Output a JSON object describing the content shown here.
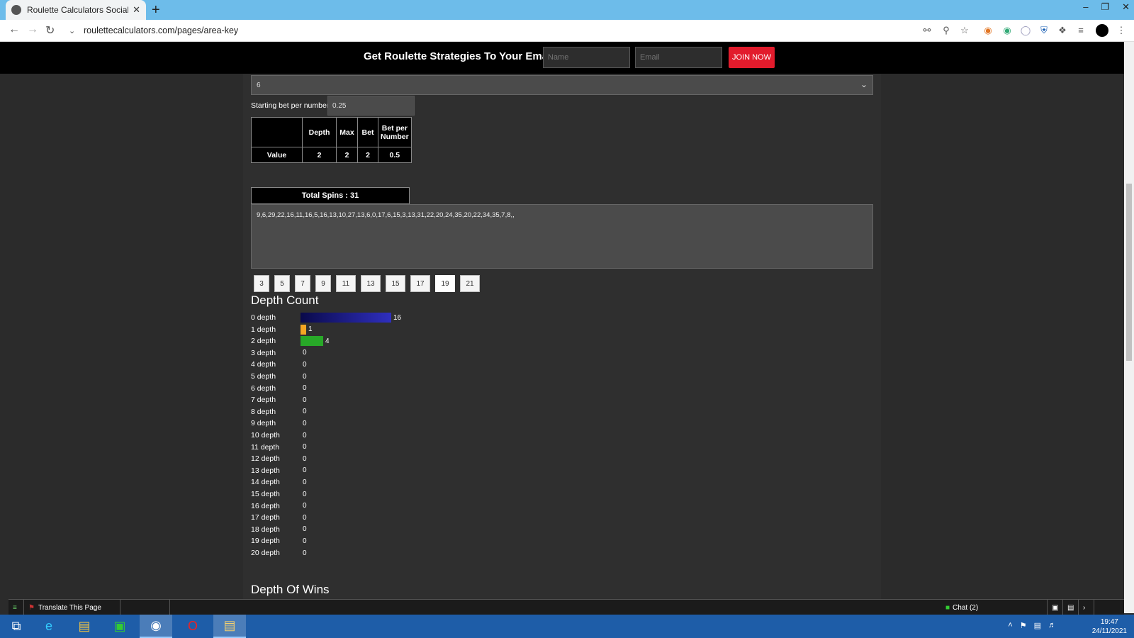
{
  "browser": {
    "tab_title": "Roulette Calculators Social Netw",
    "url": "roulettecalculators.com/pages/area-key",
    "new_tab": "+",
    "close_tab": "✕"
  },
  "promo": {
    "text": "Get Roulette Strategies To Your Email:",
    "name_placeholder": "Name",
    "email_placeholder": "Email",
    "join_label": "JOIN NOW"
  },
  "form": {
    "select_value": "6",
    "starting_bet_label": "Starting bet per number",
    "starting_bet_value": "0.25"
  },
  "value_table": {
    "headers": [
      "",
      "Depth",
      "Max",
      "Bet",
      "Bet per Number"
    ],
    "row_label": "Value",
    "values": [
      "2",
      "2",
      "2",
      "0.5"
    ]
  },
  "spins": {
    "header": "Total Spins : 31",
    "sequence": "9,6,29,22,16,11,16,5,16,13,10,27,13,6,0,17,6,15,3,13,31,22,20,24,35,20,22,34,35,7,8,,"
  },
  "number_buttons": [
    "3",
    "5",
    "7",
    "9",
    "11",
    "13",
    "15",
    "17",
    "19",
    "21"
  ],
  "depth_count": {
    "title": "Depth Count",
    "rows": [
      {
        "label": "0 depth",
        "value": "16",
        "color": "#2f2fbf"
      },
      {
        "label": "1 depth",
        "value": "1",
        "color": "#f5a623"
      },
      {
        "label": "2 depth",
        "value": "4",
        "color": "#28a828"
      },
      {
        "label": "3 depth",
        "value": "0"
      },
      {
        "label": "4 depth",
        "value": "0"
      },
      {
        "label": "5 depth",
        "value": "0"
      },
      {
        "label": "6 depth",
        "value": "0"
      },
      {
        "label": "7 depth",
        "value": "0"
      },
      {
        "label": "8 depth",
        "value": "0"
      },
      {
        "label": "9 depth",
        "value": "0"
      },
      {
        "label": "10 depth",
        "value": "0"
      },
      {
        "label": "11 depth",
        "value": "0"
      },
      {
        "label": "12 depth",
        "value": "0"
      },
      {
        "label": "13 depth",
        "value": "0"
      },
      {
        "label": "14 depth",
        "value": "0"
      },
      {
        "label": "15 depth",
        "value": "0"
      },
      {
        "label": "16 depth",
        "value": "0"
      },
      {
        "label": "17 depth",
        "value": "0"
      },
      {
        "label": "18 depth",
        "value": "0"
      },
      {
        "label": "19 depth",
        "value": "0"
      },
      {
        "label": "20 depth",
        "value": "0"
      }
    ]
  },
  "depth_of_wins": {
    "title": "Depth Of Wins"
  },
  "translate_bar": {
    "translate_label": "Translate This Page",
    "chat_label": "Chat (2)"
  },
  "taskbar": {
    "time": "19:47",
    "date": "24/11/2021"
  }
}
